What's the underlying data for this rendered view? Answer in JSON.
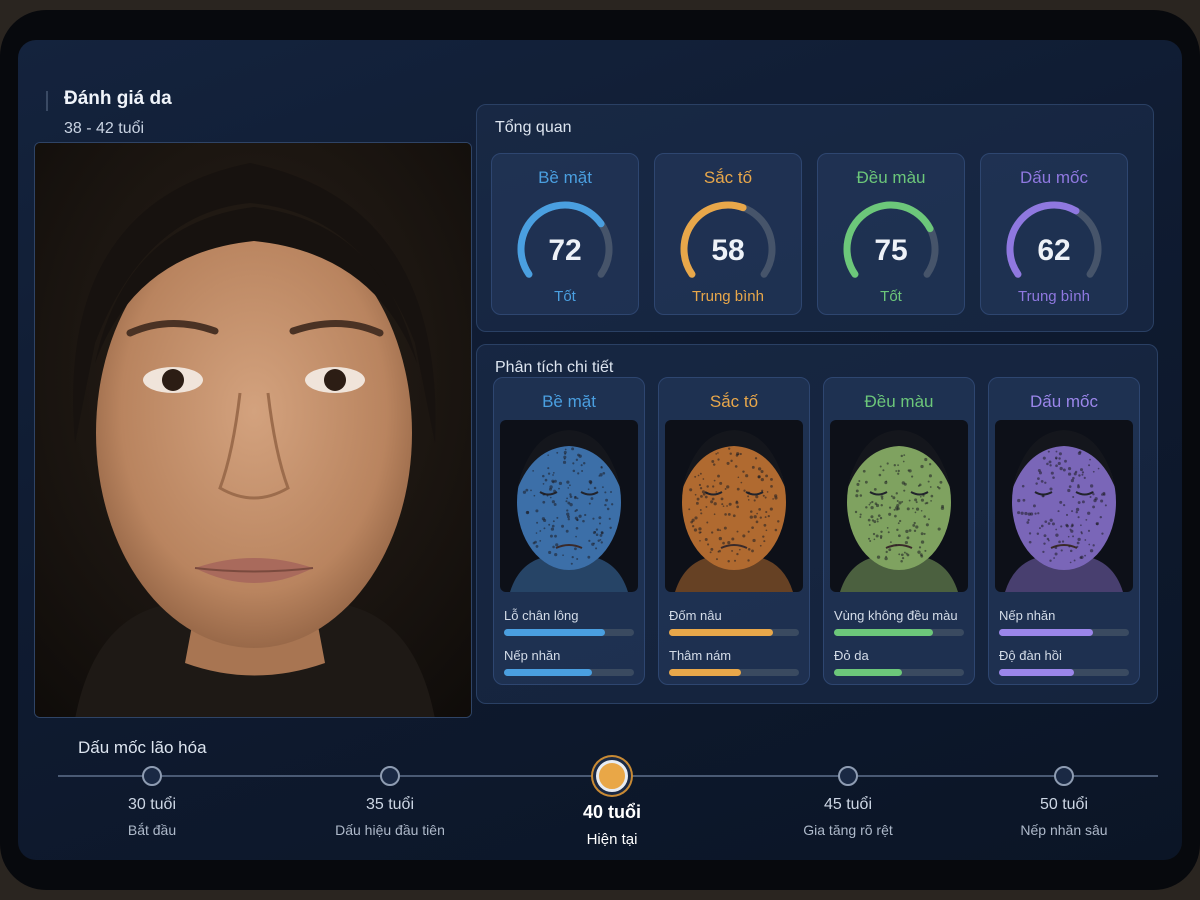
{
  "header": {
    "title": "Đánh giá da",
    "age_range": "38 - 42 tuổi"
  },
  "overview": {
    "title": "Tổng quan",
    "gauges": [
      {
        "label": "Bề mặt",
        "score": 72,
        "status": "Tốt",
        "color": "#4a9fe0"
      },
      {
        "label": "Sắc tố",
        "score": 58,
        "status": "Trung bình",
        "color": "#e8a74a"
      },
      {
        "label": "Đều màu",
        "score": 75,
        "status": "Tốt",
        "color": "#6cc77a"
      },
      {
        "label": "Dấu mốc",
        "score": 62,
        "status": "Trung bình",
        "color": "#8f78e0"
      }
    ]
  },
  "detail": {
    "title": "Phân tích chi tiết",
    "cards": [
      {
        "label": "Bề mặt",
        "color": "#4a9fe0",
        "tint": "#3c6fa8",
        "metrics": [
          {
            "label": "Lỗ chân lông",
            "value": 0.78
          },
          {
            "label": "Nếp nhăn",
            "value": 0.68
          }
        ]
      },
      {
        "label": "Sắc tố",
        "color": "#e8a74a",
        "tint": "#b06a30",
        "metrics": [
          {
            "label": "Đốm nâu",
            "value": 0.8
          },
          {
            "label": "Thâm nám",
            "value": 0.55
          }
        ]
      },
      {
        "label": "Đều màu",
        "color": "#6cc77a",
        "tint": "#7fa260",
        "metrics": [
          {
            "label": "Vùng không đều màu",
            "value": 0.76
          },
          {
            "label": "Đỏ da",
            "value": 0.52
          }
        ]
      },
      {
        "label": "Dấu mốc",
        "color": "#9b86ea",
        "tint": "#7a66b8",
        "metrics": [
          {
            "label": "Nếp nhăn",
            "value": 0.72
          },
          {
            "label": "Độ đàn hồi",
            "value": 0.58
          }
        ]
      }
    ]
  },
  "timeline": {
    "title": "Dấu mốc lão hóa",
    "milestones": [
      {
        "age": "30 tuổi",
        "desc": "Bắt đầu",
        "current": false
      },
      {
        "age": "35 tuổi",
        "desc": "Dấu hiệu đầu tiên",
        "current": false
      },
      {
        "age": "40 tuổi",
        "desc": "Hiện tại",
        "current": true
      },
      {
        "age": "45 tuổi",
        "desc": "Gia tăng rõ rệt",
        "current": false
      },
      {
        "age": "50 tuổi",
        "desc": "Nếp nhăn sâu",
        "current": false
      }
    ]
  }
}
